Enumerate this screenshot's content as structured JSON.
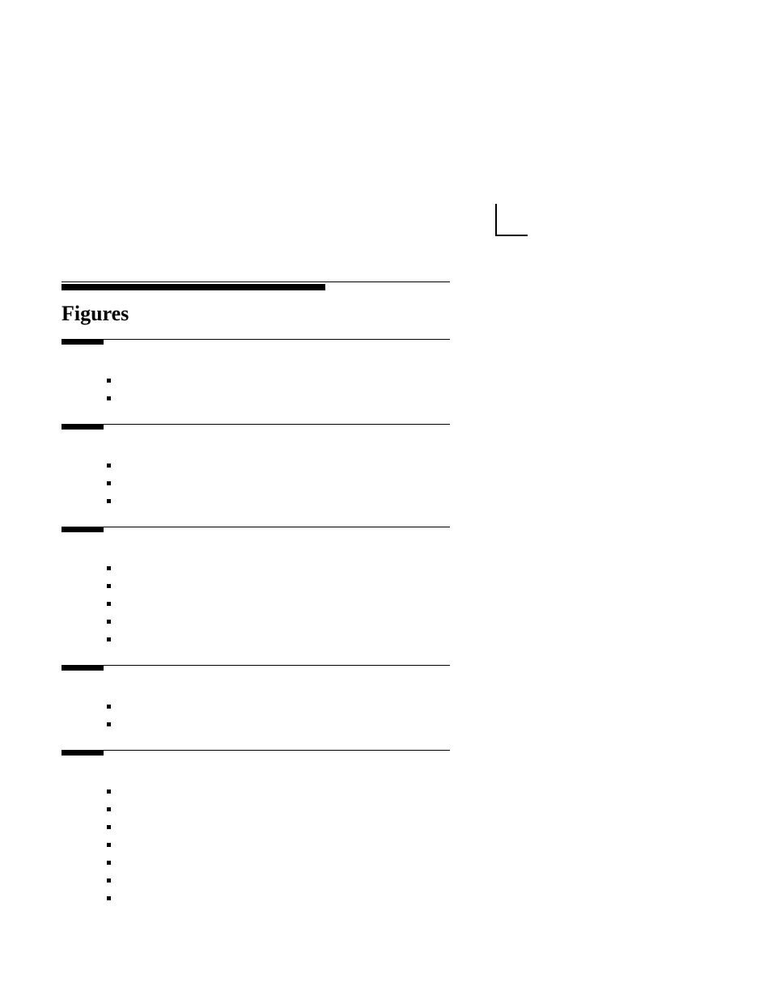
{
  "title": "Figures",
  "sections": [
    {
      "bullet_count": 2
    },
    {
      "bullet_count": 3
    },
    {
      "bullet_count": 5
    },
    {
      "bullet_count": 2
    },
    {
      "bullet_count": 7
    }
  ]
}
